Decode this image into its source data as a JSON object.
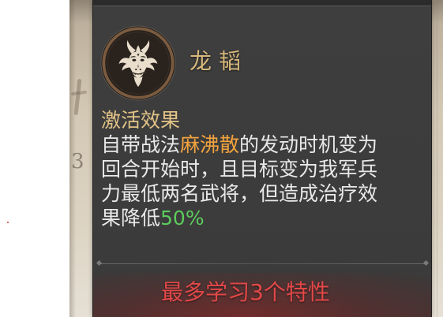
{
  "colors": {
    "panel_bg": "#3c3c3c",
    "title": "#d8b97c",
    "heading": "#e3c487",
    "body_text": "#e9e9e9",
    "skill_highlight": "#f3a33d",
    "value_highlight": "#5ccc5c",
    "limit_text": "#e34848"
  },
  "background": {
    "faint_number": "3"
  },
  "tooltip": {
    "emblem_icon": "dragon-head-icon",
    "title": "龙韬",
    "effect": {
      "heading": "激活效果",
      "lines": [
        [
          {
            "text": "自带战法"
          },
          {
            "text": "麻沸散"
          },
          {
            "text": "的发动时机变为"
          }
        ],
        [
          {
            "text": "回合开始时，且目标变为我军兵"
          }
        ],
        [
          {
            "text": "力最低两名武将，但造成治疗效"
          }
        ],
        [
          {
            "text": "果降低"
          },
          {
            "text": "50%"
          }
        ]
      ]
    },
    "footer": {
      "limit_text": "最多学习3个特性"
    }
  }
}
